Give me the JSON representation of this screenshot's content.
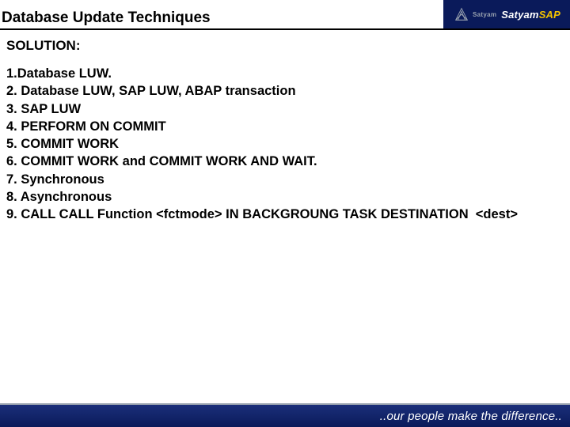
{
  "header": {
    "title": "Database Update Techniques",
    "brand_primary": "Satyam",
    "brand_suffix": "SAP",
    "satyam_label": "Satyam"
  },
  "content": {
    "solution_label": "SOLUTION:",
    "answers": [
      "1.Database LUW.",
      "2. Database LUW, SAP LUW, ABAP transaction",
      "3. SAP LUW",
      "4. PERFORM ON COMMIT",
      "5. COMMIT WORK",
      "6. COMMIT WORK and COMMIT WORK AND WAIT.",
      "7. Synchronous",
      "8. Asynchronous",
      "9. CALL CALL Function <fctmode> IN BACKGROUNG TASK DESTINATION  <dest>"
    ]
  },
  "footer": {
    "tagline": "..our people make the difference.."
  }
}
